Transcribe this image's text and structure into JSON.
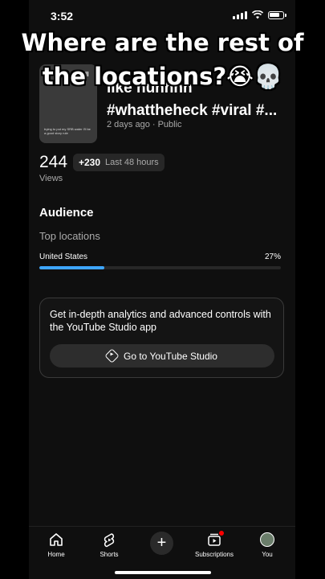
{
  "status_bar": {
    "time": "3:52"
  },
  "overlay": {
    "line1": "Where are the rest of",
    "line2": "the locations?😭💀"
  },
  "video": {
    "thumb_text_top": "aboo… holl",
    "thumb_text_bottom": "trying to put my SRB water I'll be a good story rule",
    "title_line1": "like huhhhh",
    "title_line2": "#whattheheck #viral #...",
    "meta": "2 days ago · Public"
  },
  "views": {
    "count": "244",
    "delta": "+230",
    "period": "Last 48 hours",
    "label": "Views"
  },
  "audience": {
    "heading": "Audience",
    "subheading": "Top locations",
    "locations": [
      {
        "name": "United States",
        "percent_label": "27%",
        "fraction": 0.27
      }
    ]
  },
  "promo": {
    "text": "Get in-depth analytics and advanced controls with the YouTube Studio app",
    "button_label": "Go to YouTube Studio"
  },
  "nav": {
    "home": "Home",
    "shorts": "Shorts",
    "subscriptions": "Subscriptions",
    "you": "You"
  },
  "colors": {
    "accent": "#3ea6ff",
    "background": "#0f0f0f",
    "badge": "#ff0000"
  }
}
